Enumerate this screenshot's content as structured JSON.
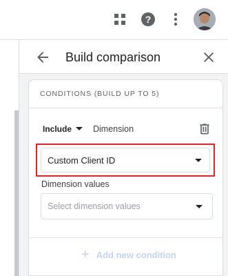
{
  "topbar": {
    "icons": [
      "apps-grid-icon",
      "help-icon",
      "more-vert-icon"
    ],
    "avatar": "user-avatar"
  },
  "panel": {
    "title": "Build comparison",
    "back_icon": "arrow-back-icon",
    "close_icon": "close-icon"
  },
  "card": {
    "conditions_label": "CONDITIONS (BUILD UP TO 5)",
    "include_label": "Include",
    "dimension_type": "Dimension",
    "dimension_selected": "Custom Client ID",
    "dimension_values_label": "Dimension values",
    "dimension_values_placeholder": "Select dimension values",
    "add_condition_label": "Add new condition"
  },
  "colors": {
    "highlight": "#d9262b",
    "disabled_blue": "#c4d3f4",
    "panel_bg": "#f1f3f4"
  }
}
